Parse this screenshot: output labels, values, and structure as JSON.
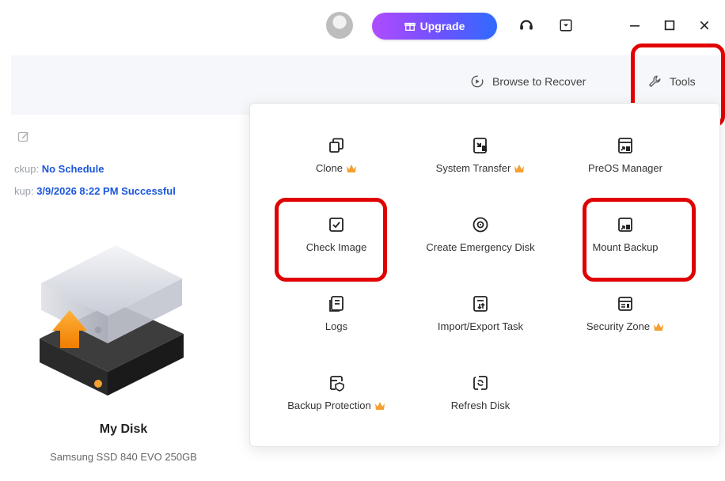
{
  "titlebar": {
    "upgrade_label": "Upgrade",
    "window_controls": [
      "minimize",
      "maximize",
      "close"
    ]
  },
  "subbar": {
    "browse_label": "Browse to Recover",
    "tools_label": "Tools"
  },
  "left": {
    "schedule_label": "ckup:",
    "schedule_value": "No Schedule",
    "last_label": "kup:",
    "last_value": "3/9/2026 8:22 PM Successful",
    "disk_name": "My Disk",
    "disk_model": "Samsung SSD 840 EVO 250GB"
  },
  "tools": [
    {
      "label": "Clone",
      "icon": "clone-icon",
      "premium": true
    },
    {
      "label": "System Transfer",
      "icon": "system-transfer-icon",
      "premium": true
    },
    {
      "label": "PreOS Manager",
      "icon": "preos-manager-icon",
      "premium": false
    },
    {
      "label": "Check Image",
      "icon": "check-image-icon",
      "premium": false
    },
    {
      "label": "Create Emergency Disk",
      "icon": "emergency-disk-icon",
      "premium": false
    },
    {
      "label": "Mount Backup",
      "icon": "mount-backup-icon",
      "premium": false
    },
    {
      "label": "Logs",
      "icon": "logs-icon",
      "premium": false
    },
    {
      "label": "Import/Export Task",
      "icon": "import-export-icon",
      "premium": false
    },
    {
      "label": "Security Zone",
      "icon": "security-zone-icon",
      "premium": true
    },
    {
      "label": "Backup Protection",
      "icon": "backup-protection-icon",
      "premium": true
    },
    {
      "label": "Refresh Disk",
      "icon": "refresh-disk-icon",
      "premium": false
    }
  ],
  "colors": {
    "accent_blue": "#1a56db",
    "premium_orange": "#f5a030",
    "highlight_red": "#e00000"
  }
}
